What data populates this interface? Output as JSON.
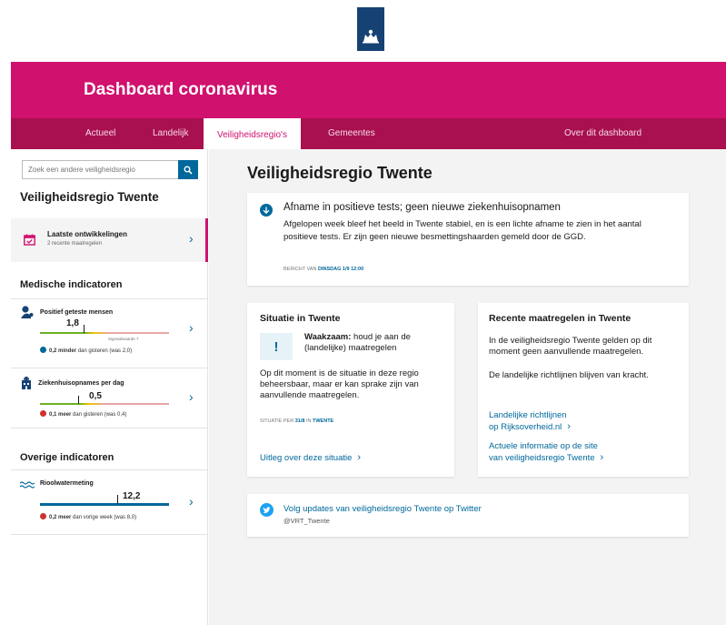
{
  "header": {
    "title": "Dashboard coronavirus",
    "logo_icon": "rijksoverheid-logo-icon",
    "colors": {
      "brand": "#d0116e",
      "nav": "#a9104f",
      "link": "#01689b",
      "logo": "#154273"
    }
  },
  "nav": {
    "tabs": [
      {
        "label": "Actueel"
      },
      {
        "label": "Landelijk"
      },
      {
        "label": "Veiligheidsregio's",
        "active": true
      },
      {
        "label": "Gemeentes"
      },
      {
        "label": "Over dit dashboard"
      }
    ]
  },
  "sidebar": {
    "search_placeholder": "Zoek een andere veiligheidsregio",
    "search_icon": "search-icon",
    "region_title": "Veiligheidsregio Twente",
    "latest": {
      "title": "Laatste ontwikkelingen",
      "subtitle": "2 recente maatregelen",
      "icon": "calendar-icon"
    },
    "medical_title": "Medische indicatoren",
    "other_title": "Overige indicatoren",
    "indicators": [
      {
        "title": "Positief geteste mensen",
        "value": "1,8",
        "level": 0.34,
        "note": "Signaalwaarde 7",
        "change_amount": "0,2",
        "change_word": "minder",
        "change_rest": "dan gisteren (was 2,0)",
        "direction": "down",
        "icon": "virus-person-icon"
      },
      {
        "title": "Ziekenhuisopnames per dag",
        "value": "0,5",
        "level": 0.3,
        "change_amount": "0,1",
        "change_word": "meer",
        "change_rest": "dan gisteren (was 0,4)",
        "direction": "up",
        "icon": "hospital-icon"
      },
      {
        "title": "Rioolwatermeting",
        "value": "12,2",
        "level": 0.62,
        "change_amount": "0,2",
        "change_word": "meer",
        "change_rest": "dan vorige week (was 8,0)",
        "direction": "up",
        "icon": "sewer-water-icon"
      }
    ]
  },
  "main": {
    "title": "Veiligheidsregio Twente",
    "news": {
      "headline": "Afname in positieve tests; geen nieuwe ziekenhuisopnamen",
      "body": "Afgelopen week bleef het beeld in Twente stabiel, en is een lichte afname te zien in het aantal positieve tests. Er zijn geen nieuwe besmettingshaarden gemeld door de GGD.",
      "meta_label": "BERICHT VAN",
      "meta_value": "DINSDAG 1/9 12:00"
    },
    "situation": {
      "title": "Situatie in Twente",
      "warn_strong": "Waakzaam:",
      "warn_rest": "houd je aan de (landelijke) maatregelen",
      "text": "Op dit moment is de situatie in deze regio beheersbaar, maar er kan sprake zijn van aanvullende maatregelen.",
      "meta_label": "SITUATIE PER",
      "meta_date": "31/8",
      "meta_in": "IN",
      "meta_region": "TWENTE",
      "link": "Uitleg over deze situatie"
    },
    "measures": {
      "title": "Recente maatregelen in Twente",
      "text1": "In de veiligheidsregio Twente gelden op dit moment geen aanvullende maatregelen.",
      "text2": "De landelijke richtlijnen blijven van kracht.",
      "link1_line1": "Landelijke richtlijnen",
      "link1_line2": "op Rijksoverheid.nl",
      "link2_line1": "Actuele informatie op de site",
      "link2_line2": "van veiligheidsregio Twente"
    },
    "twitter": {
      "link": "Volg updates van veiligheidsregio Twente op Twitter",
      "handle": "@VRT_Twente",
      "icon": "twitter-icon"
    }
  }
}
